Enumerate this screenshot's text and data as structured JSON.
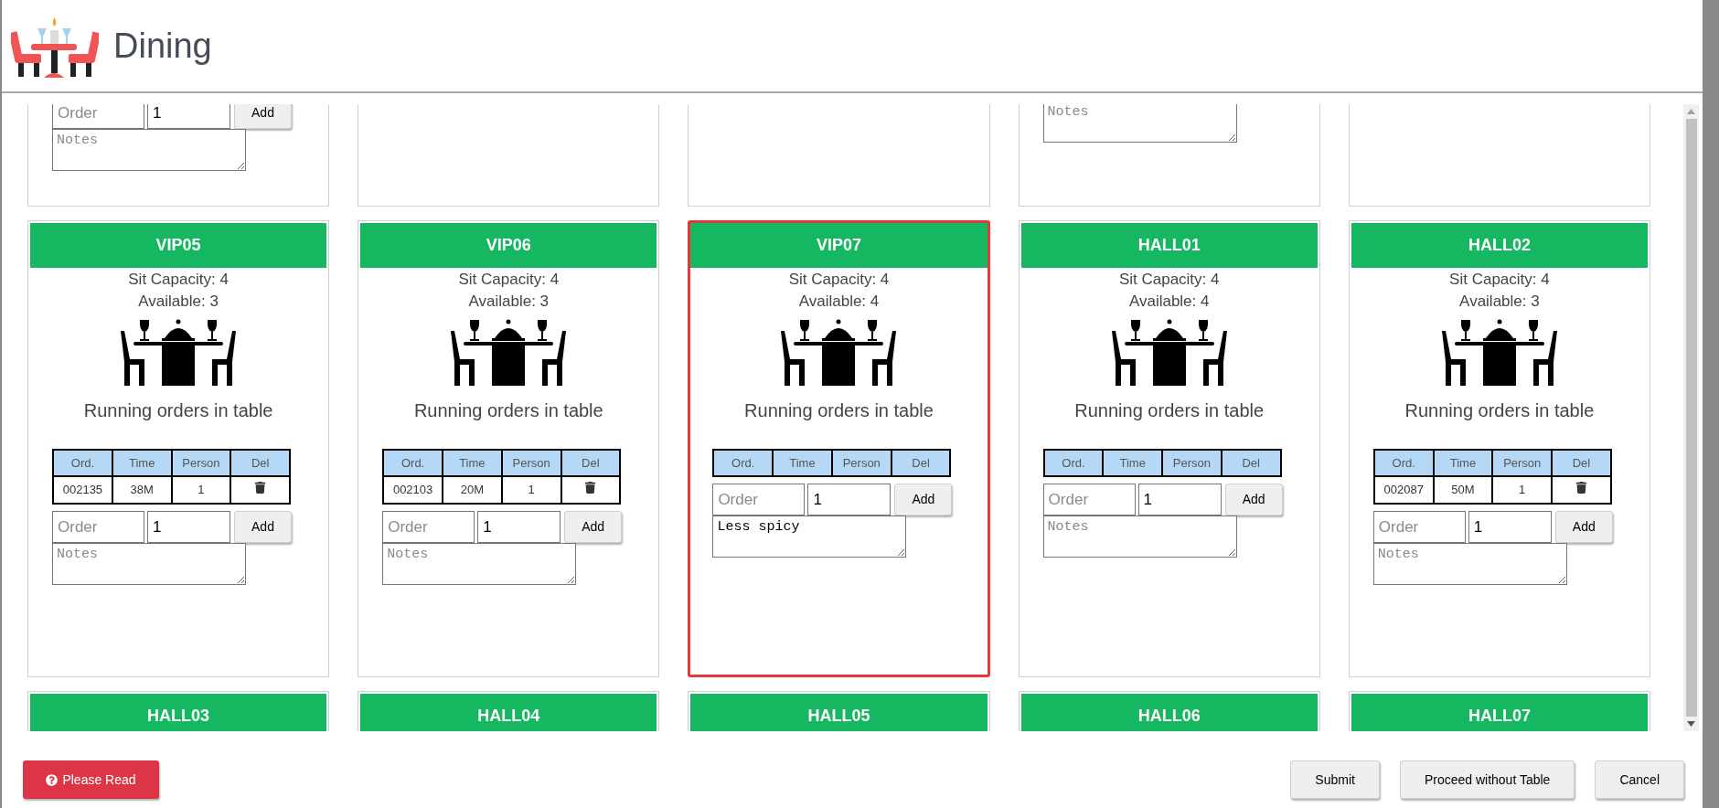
{
  "header": {
    "title": "Dining"
  },
  "top_row": [
    {
      "kind": "order_form",
      "order_placeholder": "Order",
      "quantity": "1",
      "button": "Add",
      "notes_placeholder": "Notes"
    },
    {
      "kind": "empty"
    },
    {
      "kind": "empty"
    },
    {
      "kind": "notes",
      "notes_placeholder": "Notes"
    },
    {
      "kind": "empty"
    }
  ],
  "tables": [
    {
      "name": "VIP05",
      "selected": false,
      "capacity": "Sit Capacity: 4",
      "available": "Available: 3",
      "heading": "Running orders in table",
      "columns": [
        "Ord.",
        "Time",
        "Person",
        "Del"
      ],
      "rows": [
        {
          "order": "002135",
          "time": "38M",
          "person": "1"
        }
      ],
      "order_placeholder": "Order",
      "quantity": "1",
      "button": "Add",
      "notes_placeholder": "Notes"
    },
    {
      "name": "VIP06",
      "selected": false,
      "capacity": "Sit Capacity: 4",
      "available": "Available: 3",
      "heading": "Running orders in table",
      "columns": [
        "Ord.",
        "Time",
        "Person",
        "Del"
      ],
      "rows": [
        {
          "order": "002103",
          "time": "20M",
          "person": "1"
        }
      ],
      "order_placeholder": "Order",
      "quantity": "1",
      "button": "Add",
      "notes_placeholder": "Notes"
    },
    {
      "name": "VIP07",
      "selected": true,
      "capacity": "Sit Capacity: 4",
      "available": "Available: 4",
      "heading": "Running orders in table",
      "columns": [
        "Ord.",
        "Time",
        "Person",
        "Del"
      ],
      "order_placeholder": "Order",
      "quantity": "1",
      "button": "Add",
      "notes": "Less spicy"
    },
    {
      "name": "HALL01",
      "selected": false,
      "capacity": "Sit Capacity: 4",
      "available": "Available: 4",
      "heading": "Running orders in table",
      "columns": [
        "Ord.",
        "Time",
        "Person",
        "Del"
      ],
      "order_placeholder": "Order",
      "quantity": "1",
      "button": "Add",
      "notes_placeholder": "Notes"
    },
    {
      "name": "HALL02",
      "selected": false,
      "capacity": "Sit Capacity: 4",
      "available": "Available: 3",
      "heading": "Running orders in table",
      "columns": [
        "Ord.",
        "Time",
        "Person",
        "Del"
      ],
      "rows": [
        {
          "order": "002087",
          "time": "50M",
          "person": "1"
        }
      ],
      "order_placeholder": "Order",
      "quantity": "1",
      "button": "Add",
      "notes_placeholder": "Notes"
    }
  ],
  "bottom_row": [
    {
      "name": "HALL03"
    },
    {
      "name": "HALL04"
    },
    {
      "name": "HALL05"
    },
    {
      "name": "HALL06"
    },
    {
      "name": "HALL07"
    }
  ],
  "footer": {
    "buttons": [
      {
        "kind": "help",
        "label": "Please Read"
      },
      {
        "kind": "plain",
        "label": "Submit"
      },
      {
        "kind": "plain",
        "label": "Proceed without Table"
      },
      {
        "kind": "plain",
        "label": "Cancel"
      }
    ]
  }
}
